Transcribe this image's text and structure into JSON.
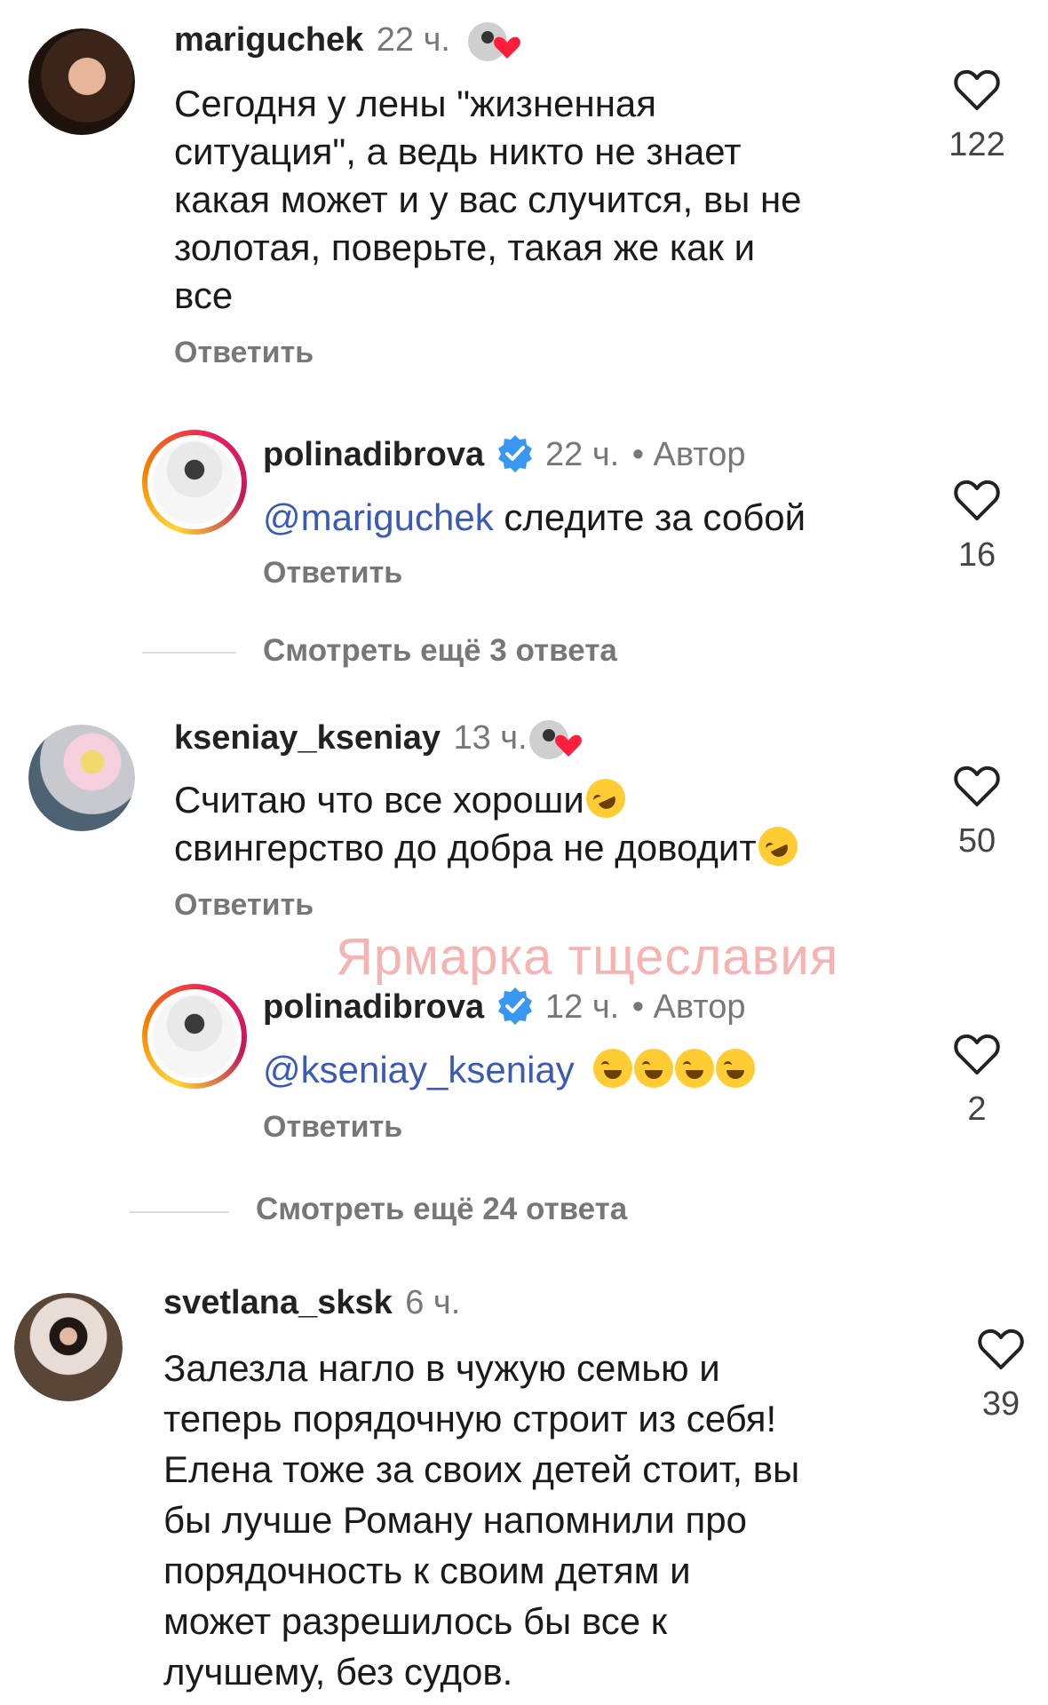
{
  "comments": [
    {
      "username": "mariguchek",
      "time": "22 ч.",
      "text_lines": [
        "Сегодня у лены \"жизненная",
        "ситуация\", а ведь никто не знает",
        "какая может и у вас случится, вы не",
        "золотая, поверьте, такая же как и",
        "все"
      ],
      "reply_label": "Ответить",
      "likes": "122",
      "author_liked": true
    },
    {
      "username": "polinadibrova",
      "time": "22 ч.",
      "author_label": "• Автор",
      "mention": "@mariguchek",
      "text": " следите за собой",
      "reply_label": "Ответить",
      "likes": "16",
      "verified": true
    },
    {
      "more_label": "Смотреть ещё 3 ответа"
    },
    {
      "username": "kseniay_kseniay",
      "time": "13 ч.",
      "text_lines": [
        "Считаю что все хороши",
        "свингерство до добра не доводит"
      ],
      "reply_label": "Ответить",
      "likes": "50",
      "author_liked": true
    },
    {
      "username": "polinadibrova",
      "time": "12 ч.",
      "author_label": "• Автор",
      "mention": "@kseniay_kseniay",
      "reply_label": "Ответить",
      "likes": "2",
      "verified": true
    },
    {
      "more_label": "Смотреть ещё 24 ответа"
    },
    {
      "username": "svetlana_sksk",
      "time": "6 ч.",
      "text_lines": [
        "Залезла нагло в чужую семью и",
        "теперь порядочную строит из себя!",
        "Елена тоже за своих детей стоит, вы",
        "бы лучше Роману напомнили про",
        "порядочность к своим детям и",
        "может разрешилось бы все к",
        "лучшему, без судов."
      ],
      "likes": "39"
    }
  ],
  "watermark": "Ярмарка тщеславия",
  "colors": {
    "mention": "#3b5ab6",
    "heart_badge": "#ff1f3d",
    "verified": "#3897f0",
    "watermark": "#f7b2b2"
  }
}
